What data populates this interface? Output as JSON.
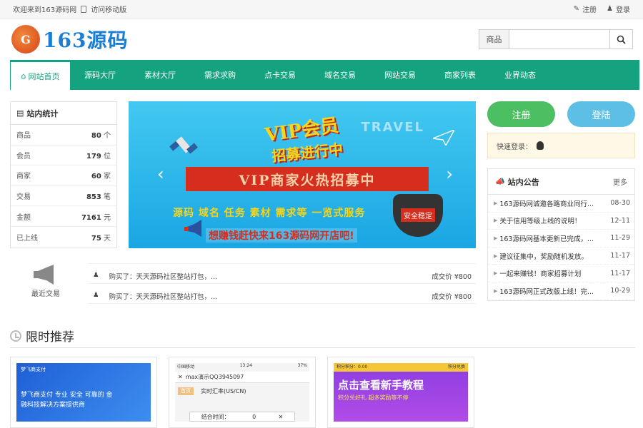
{
  "topbar": {
    "welcome": "欢迎来到163源码网",
    "mobile": "访问移动版",
    "register": "注册",
    "login": "登录"
  },
  "logo": {
    "mark": "G",
    "text": "163源码"
  },
  "search": {
    "category": "商品",
    "placeholder": ""
  },
  "nav": [
    {
      "label": "网站首页",
      "active": true
    },
    {
      "label": "源码大厅"
    },
    {
      "label": "素材大厅"
    },
    {
      "label": "需求求购"
    },
    {
      "label": "点卡交易"
    },
    {
      "label": "域名交易"
    },
    {
      "label": "网站交易"
    },
    {
      "label": "商家列表"
    },
    {
      "label": "业界动态"
    }
  ],
  "stats": {
    "title": "站内统计",
    "rows": [
      {
        "label": "商品",
        "value": "80",
        "unit": "个"
      },
      {
        "label": "会员",
        "value": "179",
        "unit": "位"
      },
      {
        "label": "商家",
        "value": "60",
        "unit": "家"
      },
      {
        "label": "交易",
        "value": "853",
        "unit": "笔"
      },
      {
        "label": "金额",
        "value": "7161",
        "unit": "元"
      },
      {
        "label": "已上线",
        "value": "75",
        "unit": "天"
      }
    ]
  },
  "banner": {
    "vip_title": "VIP会员",
    "vip_sub": "招募进行中",
    "ribbon": "VIP商家火热招募中",
    "services": "源码 域名 任务 素材 需求等 一览式服务",
    "slogan": "想赚钱赶快来163源码网开店吧!",
    "shield": "安全稳定",
    "travel": "TRAVEL",
    "prev": "‹",
    "next": "›"
  },
  "auth": {
    "register": "注册",
    "login": "登陆",
    "quick_label": "快速登录："
  },
  "notice": {
    "title": "站内公告",
    "more": "更多",
    "items": [
      {
        "text": "163源码网诚邀各路商业同行...",
        "date": "08-30"
      },
      {
        "text": "关于信用等级上线的说明！",
        "date": "12-11"
      },
      {
        "text": "163源码网基本更新已完成，...",
        "date": "11-29"
      },
      {
        "text": "建议征集中，奖励随机发放。",
        "date": "11-17"
      },
      {
        "text": "一起来赚钱！商家招募计划",
        "date": "11-17"
      },
      {
        "text": "163源码网正式改版上线！完...",
        "date": "10-29"
      }
    ]
  },
  "recent": {
    "label": "最近交易",
    "deals": [
      {
        "text": "购买了：天天源码社区整站打包，...",
        "price": "成交价 ¥800"
      },
      {
        "text": "购买了：天天源码社区整站打包，...",
        "price": "成交价 ¥800"
      }
    ]
  },
  "section": {
    "title": "限时推荐"
  },
  "cards": {
    "card1": {
      "brand": "梦飞商支付",
      "slogan1": "梦飞商支付 专业 安全 可靠的 金",
      "slogan2": "融科技解决方案提供商"
    },
    "card2": {
      "carrier": "中国移动",
      "clock": "13:24",
      "battery": "37%",
      "chat": "max演示QQ3945097",
      "tag": "首页",
      "rate": "实时汇率(US/CN)",
      "time_label": "结合时间：",
      "time_value": "0",
      "close": "✕"
    },
    "card3": {
      "score": "积分积分：0.00",
      "score_right": "积分兑换",
      "big": "点击查看新手教程",
      "small": "积分兑好礼 超多奖励等不停"
    }
  },
  "colors": {
    "brand": "#14a37e",
    "register": "#4cbf63",
    "login": "#5ebfe6"
  }
}
